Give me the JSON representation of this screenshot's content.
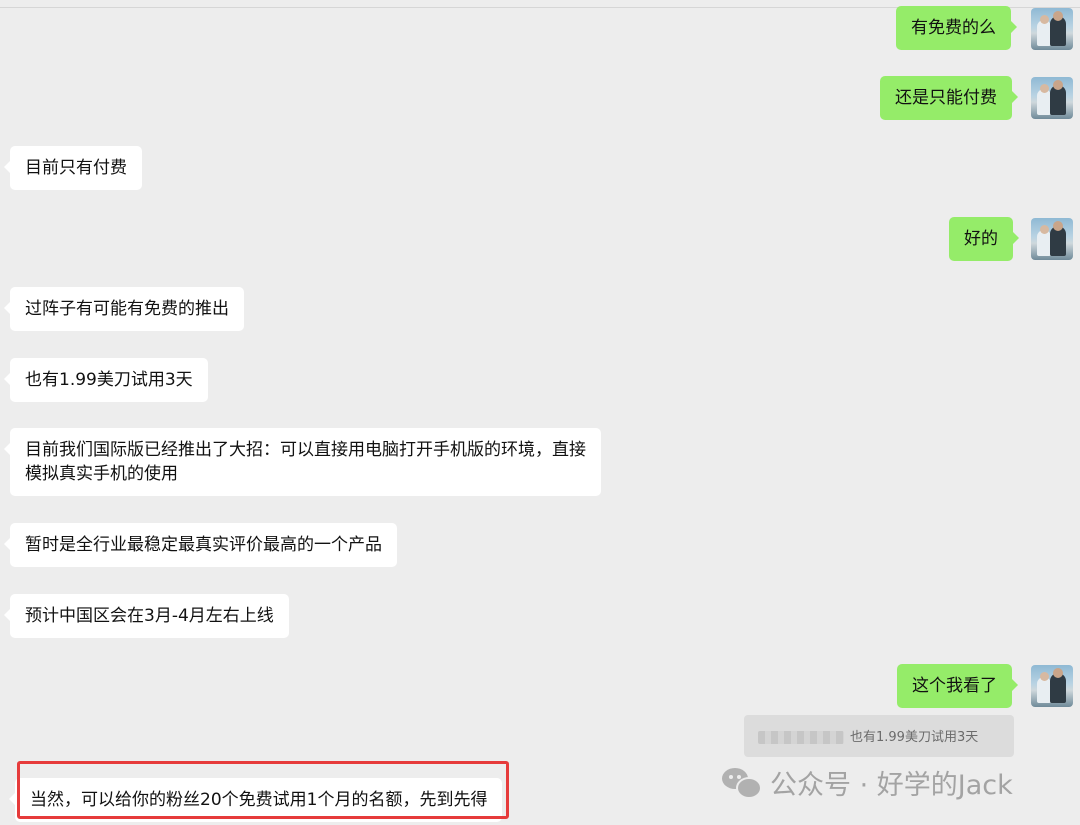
{
  "messages": [
    {
      "side": "out",
      "text": "有免费的么"
    },
    {
      "side": "out",
      "text": "还是只能付费"
    },
    {
      "side": "in",
      "text": "目前只有付费"
    },
    {
      "side": "out",
      "text": "好的"
    },
    {
      "side": "in",
      "text": "过阵子有可能有免费的推出"
    },
    {
      "side": "in",
      "text": "也有1.99美刀试用3天"
    },
    {
      "side": "in",
      "text": "目前我们国际版已经推出了大招：可以直接用电脑打开手机版的环境，直接",
      "text2": "模拟真实手机的使用"
    },
    {
      "side": "in",
      "text": "暂时是全行业最稳定最真实评价最高的一个产品"
    },
    {
      "side": "in",
      "text": "预计中国区会在3月-4月左右上线"
    },
    {
      "side": "out",
      "text": "这个我看了"
    },
    {
      "side": "in",
      "text": "当然，可以给你的粉丝20个免费试用1个月的名额，先到先得"
    }
  ],
  "quote": {
    "text": "也有1.99美刀试用3天"
  },
  "watermark": {
    "text": "公众号 · 好学的Jack"
  },
  "colors": {
    "outgoing_bubble": "#95ec69",
    "incoming_bubble": "#ffffff",
    "background": "#ededed",
    "highlight_border": "#e63b3b"
  },
  "icons": {
    "avatar": "user-avatar-photo",
    "watermark": "wechat-icon"
  }
}
